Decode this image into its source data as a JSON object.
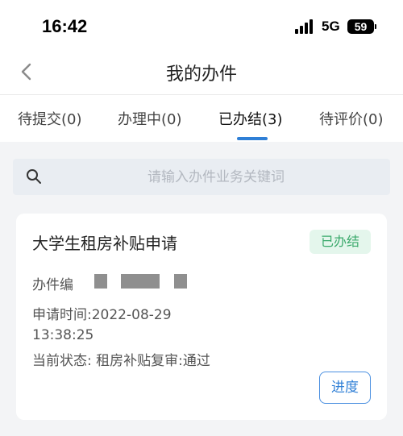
{
  "status_bar": {
    "time": "16:42",
    "network": "5G",
    "battery": "59"
  },
  "nav": {
    "title": "我的办件",
    "back_icon": "chevron-left-icon"
  },
  "tabs": [
    {
      "label": "待提交(0)",
      "active": false
    },
    {
      "label": "办理中(0)",
      "active": false
    },
    {
      "label": "已办结(3)",
      "active": true
    },
    {
      "label": "待评价(0)",
      "active": false
    }
  ],
  "search": {
    "placeholder": "请输入办件业务关键词",
    "value": "",
    "icon": "search-icon"
  },
  "records": [
    {
      "title": "大学生租房补贴申请",
      "status": "已办结",
      "number_label": "办件编",
      "apply_time": "申请时间:2022-08-29 13:38:25",
      "current_state": "当前状态: 租房补贴复审:通过",
      "action_label": "进度"
    }
  ],
  "colors": {
    "accent": "#2f7fd6",
    "status_badge_bg": "#e4f6ec",
    "status_badge_text": "#3aa96b",
    "background": "#f3f4f6"
  }
}
